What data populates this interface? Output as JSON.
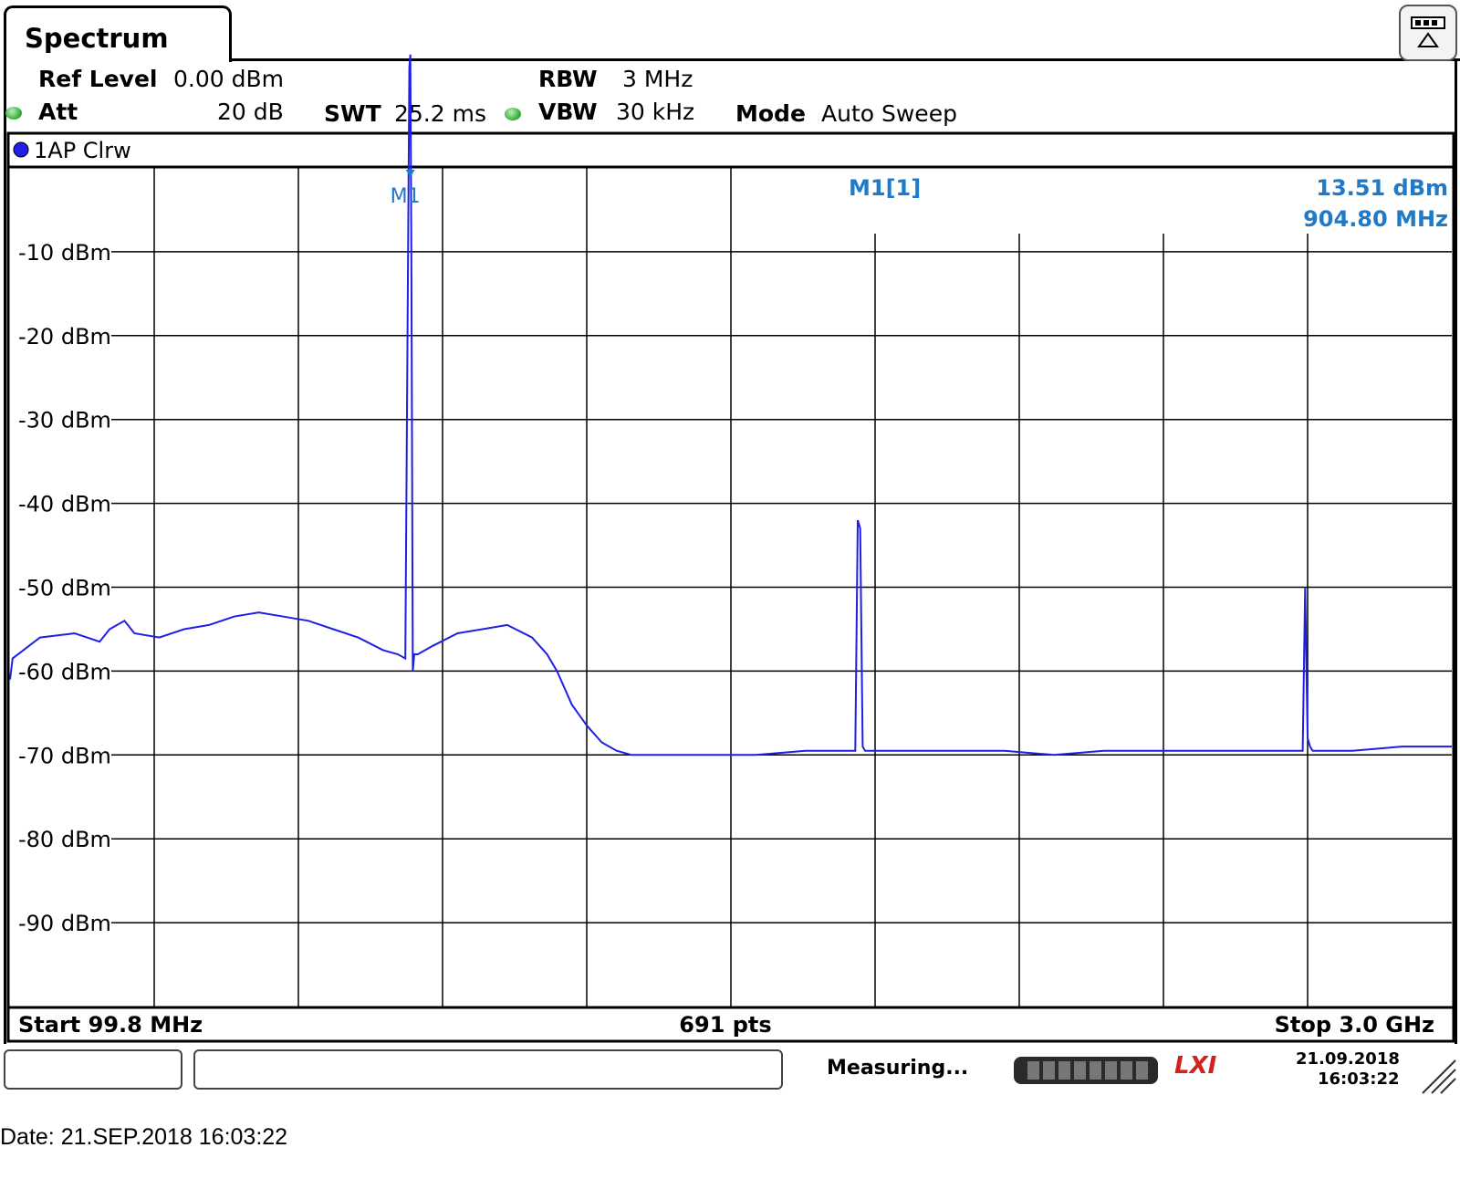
{
  "tab_title": "Spectrum",
  "header": {
    "ref_level_label": "Ref Level",
    "ref_level_value": "0.00 dBm",
    "att_label": "Att",
    "att_value": "20 dB",
    "swt_label": "SWT",
    "swt_value": "25.2 ms",
    "rbw_label": "RBW",
    "rbw_value": "3 MHz",
    "vbw_label": "VBW",
    "vbw_value": "30 kHz",
    "mode_label": "Mode",
    "mode_value": "Auto Sweep"
  },
  "trace_label": "1AP Clrw",
  "marker": {
    "name": "M1",
    "readout_name": "M1[1]",
    "level": "13.51 dBm",
    "freq": "904.80 MHz",
    "color": "#1f7ac8"
  },
  "footer": {
    "start": "Start 99.8 MHz",
    "points": "691 pts",
    "stop": "Stop 3.0 GHz"
  },
  "status": {
    "text": "Measuring...",
    "lxi": "LXI",
    "date": "21.09.2018",
    "time": "16:03:22"
  },
  "date_line": "Date: 21.SEP.2018  16:03:22",
  "chart_data": {
    "type": "line",
    "trace_color": "#1f1fe6",
    "x_unit": "MHz",
    "xlim": [
      99.8,
      3000
    ],
    "ylim": [
      -100,
      0
    ],
    "y_ticks": [
      -10,
      -20,
      -30,
      -40,
      -50,
      -60,
      -70,
      -80,
      -90
    ],
    "y_tick_labels": [
      "-10 dBm",
      "-20 dBm",
      "-30 dBm",
      "-40 dBm",
      "-50 dBm",
      "-60 dBm",
      "-70 dBm",
      "-80 dBm",
      "-90 dBm"
    ],
    "x_divisions": 10,
    "y_divisions": 10,
    "grid": true,
    "series": [
      {
        "x": [
          99.8,
          105,
          160,
          230,
          280,
          300,
          330,
          350,
          400,
          450,
          500,
          550,
          600,
          650,
          700,
          750,
          800,
          850,
          880,
          895,
          900,
          903,
          905,
          907,
          910,
          913,
          920,
          950,
          1000,
          1050,
          1100,
          1150,
          1180,
          1200,
          1230,
          1260,
          1290,
          1320,
          1350,
          1400,
          1500,
          1600,
          1700,
          1750,
          1800,
          1805,
          1810,
          1815,
          1820,
          1900,
          2000,
          2100,
          2200,
          2300,
          2400,
          2500,
          2600,
          2700,
          2705,
          2710,
          2715,
          2720,
          2800,
          2900,
          3000
        ],
        "y": [
          -61,
          -58.5,
          -56,
          -55.5,
          -56.5,
          -55,
          -54,
          -55.5,
          -56,
          -55,
          -54.5,
          -53.5,
          -53,
          -53.5,
          -54,
          -55,
          -56,
          -57.5,
          -58,
          -58.5,
          -15,
          12,
          13.51,
          -10,
          -60,
          -58,
          -58,
          -57,
          -55.5,
          -55,
          -54.5,
          -56,
          -58,
          -60,
          -64,
          -66.5,
          -68.5,
          -69.5,
          -70,
          -70,
          -70,
          -70,
          -69.5,
          -69.5,
          -69.5,
          -42,
          -43,
          -69,
          -69.5,
          -69.5,
          -69.5,
          -69.5,
          -70,
          -69.5,
          -69.5,
          -69.5,
          -69.5,
          -69.5,
          -50,
          -68,
          -69,
          -69.5,
          -69.5,
          -69,
          -69
        ]
      }
    ]
  }
}
